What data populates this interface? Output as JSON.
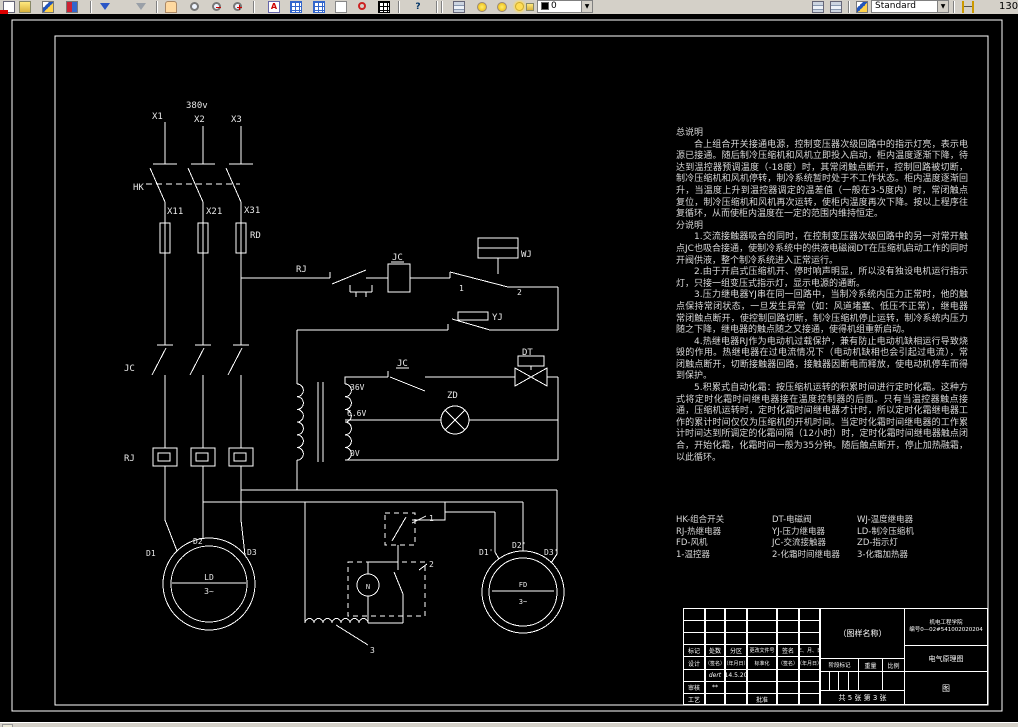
{
  "toolbar": {
    "layer_field": "0",
    "text_style_field": "Standard",
    "dim_value": "130",
    "glyphs": {
      "help": "?",
      "layer_tool": "A"
    },
    "icon_names": [
      "new",
      "open",
      "pencil-edit",
      "color-swatch",
      "undo",
      "redo",
      "pan",
      "zoom-realtime",
      "zoom-out",
      "zoom-in",
      "layer-tools",
      "named-views",
      "viewports",
      "sheet-set",
      "redraw",
      "table",
      "help",
      "layers",
      "bulb-on",
      "bulb-off",
      "sun",
      "layer-combo",
      "make-object-layer",
      "layer-previous",
      "style-edit",
      "text-style-combo",
      "dim-style",
      "dim-value"
    ]
  },
  "drawing": {
    "labels": {
      "supply_voltage": "380v",
      "x1": "X1",
      "x2": "X2",
      "x3": "X3",
      "hk": "HK",
      "x11": "X11",
      "x21": "X21",
      "x31": "X31",
      "rd": "RD",
      "jc_main": "JC",
      "rj_heater": "RJ",
      "rj_contact": "RJ",
      "jc_coil": "JC",
      "wj": "WJ",
      "term1": "1",
      "term2": "2",
      "yj": "YJ",
      "jc_aux": "JC",
      "dt": "DT",
      "v36": "36V",
      "v66": "6.6V",
      "v0": "0V",
      "zd": "ZD",
      "d1": "D1",
      "d2": "D2",
      "d3": "D3",
      "motor1_name": "LD",
      "motor1_phase": "3~",
      "d1p": "D1'",
      "d2p": "D2'",
      "d3p": "D3'",
      "motor2_name": "FD",
      "motor2_phase": "3~",
      "n": "N",
      "ptr1": "1",
      "ptr2": "2",
      "ptr3": "3"
    }
  },
  "notes": {
    "general_title": "总说明",
    "general_body": "合上组合开关接通电源，控制变压器次级回路中的指示灯亮，表示电源已接通。随后制冷压缩机和风机立即投入启动，柜内温度逐渐下降，待达到温控器预调温度（-18度）时，其常闭触点断开，控制回路被切断，制冷压缩机和风机停转，制冷系统暂时处于不工作状态。柜内温度逐渐回升，当温度上升到温控器调定的温差值（一般在3-5度内）时，常闭触点复位，制冷压缩机和风机再次运转，使柜内温度再次下降。按以上程序往复循环，从而使柜内温度在一定的范围内维持恒定。",
    "detail_title": "分说明",
    "items": [
      "1.交流接触器吸合的同时，在控制变压器次级回路中的另一对常开触点JC也吸合接通，使制冷系统中的供液电磁阀DT在压缩机启动工作的同时开阀供液，整个制冷系统进入正常运行。",
      "2.由于开启式压缩机开、停时响声明显，所以没有独设电机运行指示灯，只接一组变压式指示灯，显示电源的通断。",
      "3.压力继电器YJ串在同一回路中，当制冷系统内压力正常时，他的触点保持常闭状态，一旦发生异常（如：风道堵塞、低压不正常），继电器常闭触点断开，使控制回路切断，制冷压缩机停止运转，制冷系统内压力随之下降，继电器的触点随之又接通，使得机组重新启动。",
      "4.热继电器RJ作为电动机过载保护，兼有防止电动机缺相运行导致烧毁的作用。热继电器在过电流情况下（电动机缺相也会引起过电流），常闭触点断开，切断接触器回路，接触器因断电而释放，使电动机停车而得到保护。",
      "5.积累式自动化霜：按压缩机运转的积累时间进行定时化霜。这种方式将定时化霜时间继电器接在温度控制器的后面。只有当温控器触点接通，压缩机运转时，定时化霜时间继电器才计时，所以定时化霜继电器工作的累计时间仅仅为压缩机的开机时间。当定时化霜时间继电器的工作累计时间达到所调定的化霜间隔（12小时）时，定时化霜时间继电器触点闭合，开始化霜，化霜时间一般为35分钟。随后触点断开，停止加热融霜，以此循环。"
    ]
  },
  "legend": {
    "col1": [
      "HK-组合开关",
      "RJ-热继电器",
      "FD-风机",
      "1-温控器"
    ],
    "col2": [
      "DT-电磁阀",
      "YJ-压力继电器",
      "JC-交流接触器",
      "2-化霜时间继电器"
    ],
    "col3": [
      "WJ-温度继电器",
      "LD-制冷压缩机",
      "ZD-指示灯",
      "3-化霜加热器"
    ]
  },
  "titleblock": {
    "rev_headers": [
      "标记",
      "处数",
      "分区",
      "更改文件号",
      "签名",
      "年、月、日"
    ],
    "design_row": [
      "设计",
      "（签名）",
      "（年月日）",
      "标准化",
      "（签名）",
      "（年月日）"
    ],
    "sig": "dert",
    "date": "14.5.20",
    "check_label": "审核",
    "check_sig": "**",
    "craft_label": "工艺",
    "approve_label": "批准",
    "drawing_name": "（图样名称）",
    "stage_label": "阶段标记",
    "weight_label": "重量",
    "scale_label": "比例",
    "sheet_info": "共 5 张  第 3 张",
    "org_line1": "机电工程学院",
    "org_line2": "编号0—02#541002020204",
    "doc_type": "电气原理图",
    "mark": "图"
  }
}
